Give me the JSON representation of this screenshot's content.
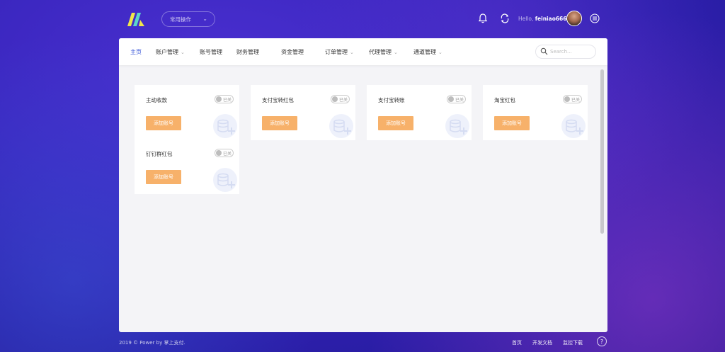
{
  "header": {
    "quick_select": "常用操作",
    "greeting_prefix": "Hello,",
    "username": "feiniao666"
  },
  "nav": {
    "items": [
      {
        "label": "主页",
        "dropdown": false,
        "active": true
      },
      {
        "label": "账户管理",
        "dropdown": true
      },
      {
        "label": "账号管理",
        "dropdown": false
      },
      {
        "label": "财务管理",
        "dropdown": false
      },
      {
        "label": "资金管理",
        "dropdown": false
      },
      {
        "label": "订单管理",
        "dropdown": true
      },
      {
        "label": "代理管理",
        "dropdown": true
      },
      {
        "label": "通道管理",
        "dropdown": true
      }
    ],
    "search_placeholder": "Search..."
  },
  "cards": [
    {
      "title": "主动收款",
      "toggle": "已关",
      "button": "添加账号"
    },
    {
      "title": "支付宝转红包",
      "toggle": "已关",
      "button": "添加账号"
    },
    {
      "title": "支付宝转账",
      "toggle": "已关",
      "button": "添加账号"
    },
    {
      "title": "淘宝红包",
      "toggle": "已关",
      "button": "添加账号"
    },
    {
      "title": "钉钉群红包",
      "toggle": "已关",
      "button": "添加账号"
    }
  ],
  "footer": {
    "copyright": "2019 © Power by 掌上支付.",
    "links": [
      "首页",
      "开发文档",
      "监控下载"
    ],
    "help": "?"
  },
  "colors": {
    "accent": "#3d5ad8",
    "button": "#f7b16a",
    "background": "#3b27c0"
  }
}
